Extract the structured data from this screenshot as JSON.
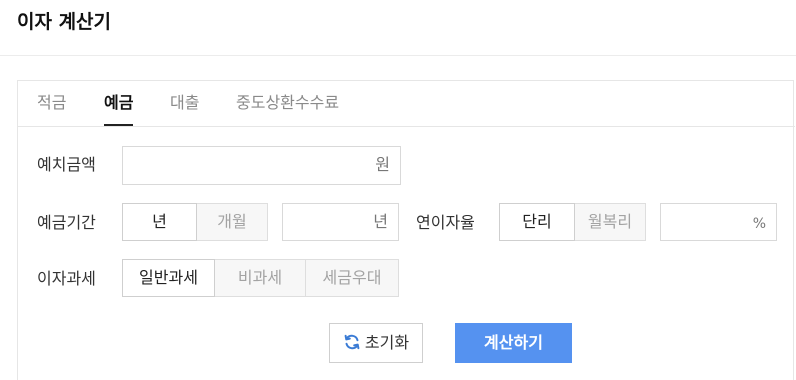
{
  "header": {
    "title": "이자 계산기"
  },
  "tabs": [
    {
      "label": "적금",
      "active": false
    },
    {
      "label": "예금",
      "active": true
    },
    {
      "label": "대출",
      "active": false
    },
    {
      "label": "중도상환수수료",
      "active": false
    }
  ],
  "deposit_amount": {
    "label": "예치금액",
    "value": "",
    "unit": "원"
  },
  "deposit_period": {
    "label": "예금기간",
    "options": [
      {
        "label": "년",
        "selected": true
      },
      {
        "label": "개월",
        "selected": false
      }
    ],
    "value": "",
    "unit": "년"
  },
  "annual_rate": {
    "label": "연이자율",
    "options": [
      {
        "label": "단리",
        "selected": true
      },
      {
        "label": "월복리",
        "selected": false
      }
    ],
    "value": "",
    "unit": "%"
  },
  "interest_tax": {
    "label": "이자과세",
    "options": [
      {
        "label": "일반과세",
        "selected": true
      },
      {
        "label": "비과세",
        "selected": false
      },
      {
        "label": "세금우대",
        "selected": false
      }
    ]
  },
  "actions": {
    "reset_label": "초기화",
    "calculate_label": "계산하기"
  },
  "colors": {
    "primary_button": "#5592f0",
    "reset_icon": "#3a7bd5"
  }
}
